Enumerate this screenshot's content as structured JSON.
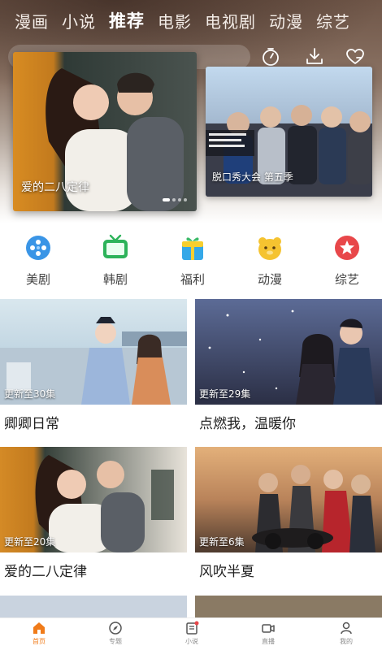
{
  "top_tabs": [
    "漫画",
    "小说",
    "推荐",
    "电影",
    "电视剧",
    "动漫",
    "综艺"
  ],
  "active_tab": "推荐",
  "toolbar_icons": [
    "timer-icon",
    "download-icon",
    "heart-icon"
  ],
  "carousel": {
    "main": {
      "title": "爱的二八定律"
    },
    "side": {
      "title": "脱口秀大会 第五季"
    }
  },
  "categories": [
    {
      "label": "美剧",
      "icon": "globe-icon",
      "color": "#3a95e6"
    },
    {
      "label": "韩剧",
      "icon": "tv-icon",
      "color": "#2db35a"
    },
    {
      "label": "福利",
      "icon": "gift-box-icon",
      "color": "#35a8e8"
    },
    {
      "label": "动漫",
      "icon": "bear-icon",
      "color": "#f5c330"
    },
    {
      "label": "综艺",
      "icon": "star-icon",
      "color": "#e8474a"
    }
  ],
  "cards": [
    {
      "title": "卿卿日常",
      "badge": "更新至30集"
    },
    {
      "title": "点燃我，温暖你",
      "badge": "更新至29集"
    },
    {
      "title": "爱的二八定律",
      "badge": "更新至20集"
    },
    {
      "title": "风吹半夏",
      "badge": "更新至6集"
    }
  ],
  "bottom_nav": [
    {
      "label": "首页",
      "icon": "home-icon",
      "active": true
    },
    {
      "label": "专题",
      "icon": "compass-icon",
      "active": false
    },
    {
      "label": "小说",
      "icon": "book-icon",
      "active": false
    },
    {
      "label": "直播",
      "icon": "video-icon",
      "active": false
    },
    {
      "label": "我的",
      "icon": "user-icon",
      "active": false
    }
  ],
  "colors": {
    "accent": "#f07b19",
    "text": "#222222"
  }
}
